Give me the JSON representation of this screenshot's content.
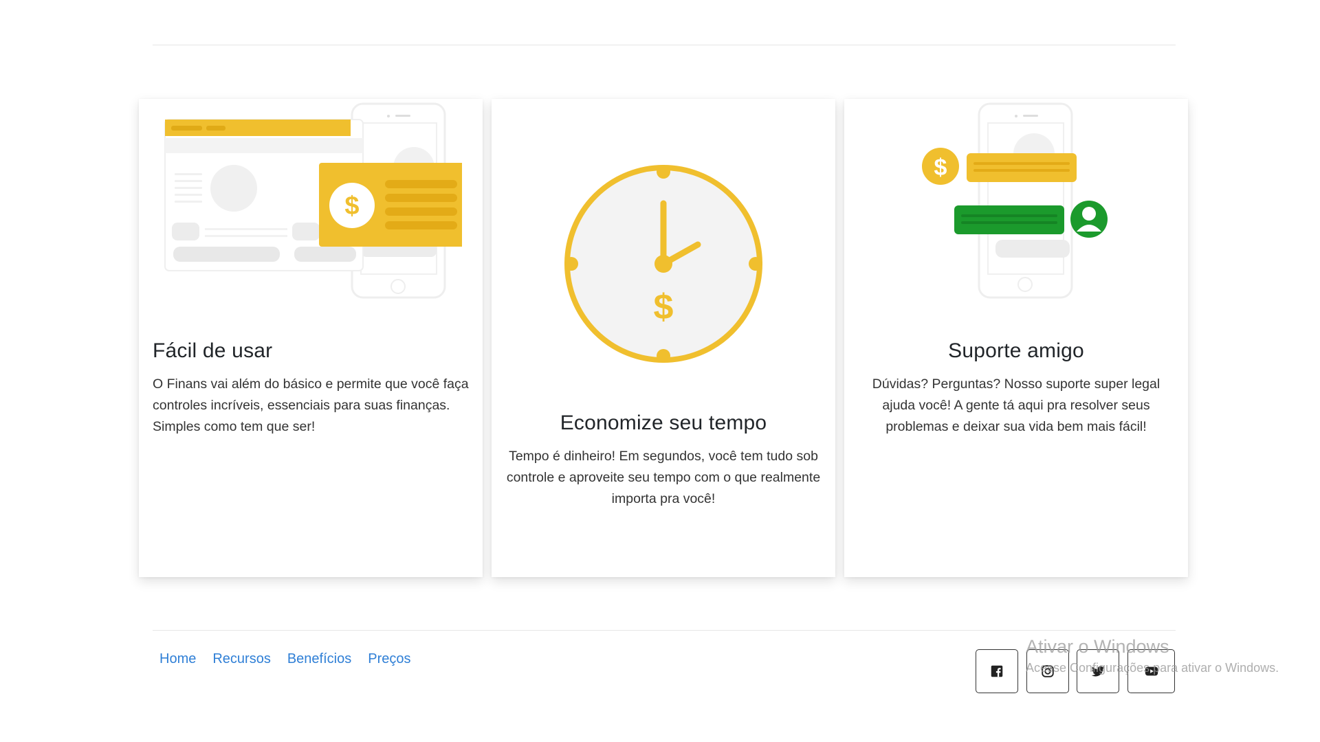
{
  "cards": [
    {
      "title": "Fácil de usar",
      "text": "O Finans vai além do básico e permite que você faça controles incríveis, essenciais para suas finanças. Simples como tem que ser!",
      "illustration_icon": "dashboard-phone-payment-illustration"
    },
    {
      "title": "Economize seu tempo",
      "text": "Tempo é dinheiro! Em segundos, você tem tudo sob controle e aproveite seu tempo com o que realmente importa pra você!",
      "illustration_icon": "clock-dollar-illustration"
    },
    {
      "title": "Suporte amigo",
      "text": "Dúvidas? Perguntas? Nosso suporte super legal ajuda você! A gente tá aqui pra resolver seus problemas e deixar sua vida bem mais fácil!",
      "illustration_icon": "chat-support-illustration"
    }
  ],
  "footer": {
    "links": [
      "Home",
      "Recursos",
      "Benefícios",
      "Preços"
    ],
    "social": [
      {
        "icon": "facebook-icon"
      },
      {
        "icon": "instagram-icon"
      },
      {
        "icon": "twitter-icon"
      },
      {
        "icon": "youtube-icon"
      }
    ]
  },
  "watermark": {
    "title": "Ativar o Windows",
    "subtitle": "Acesse Configurações para ativar o Windows."
  },
  "colors": {
    "accent_yellow": "#f0bf2e",
    "green": "#1b9a2c",
    "link_blue": "#2f7fd6",
    "text": "#212529"
  }
}
